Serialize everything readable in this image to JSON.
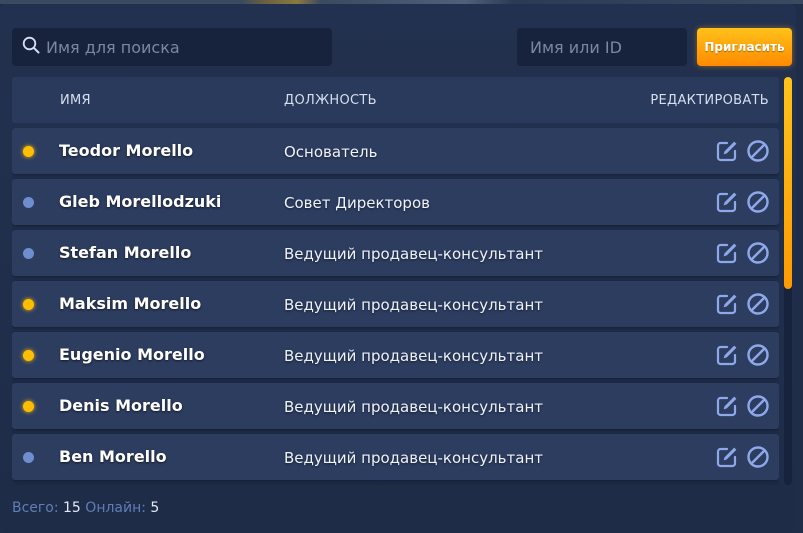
{
  "search": {
    "placeholder": "Имя для поиска",
    "id_placeholder": "Имя или ID"
  },
  "invite_button": "Пригласить",
  "table": {
    "headers": {
      "name": "ИМЯ",
      "position": "ДОЛЖНОСТЬ",
      "edit": "РЕДАКТИРОВАТЬ"
    },
    "rows": [
      {
        "name": "Teodor Morello",
        "position": "Основатель",
        "status": "online"
      },
      {
        "name": "Gleb Morellodzuki",
        "position": "Совет Директоров",
        "status": "offline"
      },
      {
        "name": "Stefan Morello",
        "position": "Ведущий продавец-консультант",
        "status": "offline"
      },
      {
        "name": "Maksim Morello",
        "position": "Ведущий продавец-консультант",
        "status": "online"
      },
      {
        "name": "Eugenio Morello",
        "position": "Ведущий продавец-консультант",
        "status": "online"
      },
      {
        "name": "Denis Morello",
        "position": "Ведущий продавец-консультант",
        "status": "online"
      },
      {
        "name": "Ben Morello",
        "position": "Ведущий продавец-консультант",
        "status": "offline"
      },
      {
        "name": "",
        "position": "",
        "status": "offline"
      }
    ]
  },
  "footer": {
    "total_label": "Всего:",
    "total_value": "15",
    "online_label": "Онлайн:",
    "online_value": "5"
  },
  "colors": {
    "online": "#ffbf00",
    "offline": "#6f8ed0",
    "accent": "#ffa200",
    "icon": "#8fa8ea"
  },
  "scroll": {
    "fraction_visible": 0.52,
    "position": 0
  },
  "icons": {
    "search": "search-icon",
    "edit": "edit-icon",
    "remove": "block-icon"
  }
}
